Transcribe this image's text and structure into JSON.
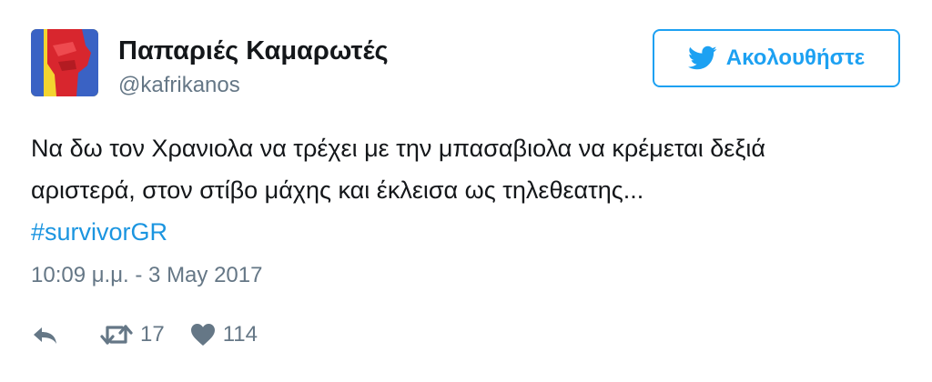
{
  "user": {
    "display_name": "Παπαριές Καμαρωτές",
    "handle": "@kafrikanos",
    "avatar_icon": "red-hand-glove-avatar"
  },
  "follow_button": {
    "label": "Ακολουθήστε",
    "icon": "twitter-bird-icon",
    "color": "#1da1f2"
  },
  "tweet": {
    "text_line_1": "Να δω τον Χρανιολα να τρέχει με την μπασαβιολα να κρέμεται δεξιά",
    "text_line_2": "αριστερά, στον στίβο μάχης και έκλεισα ως τηλεθεατης...",
    "hashtag": "#survivorGR",
    "hashtag_color": "#1b95e0",
    "timestamp": "10:09 μ.μ. - 3 May 2017"
  },
  "actions": {
    "reply_icon": "reply-icon",
    "retweet_icon": "retweet-icon",
    "retweet_count": "17",
    "like_icon": "heart-icon",
    "like_count": "114"
  }
}
